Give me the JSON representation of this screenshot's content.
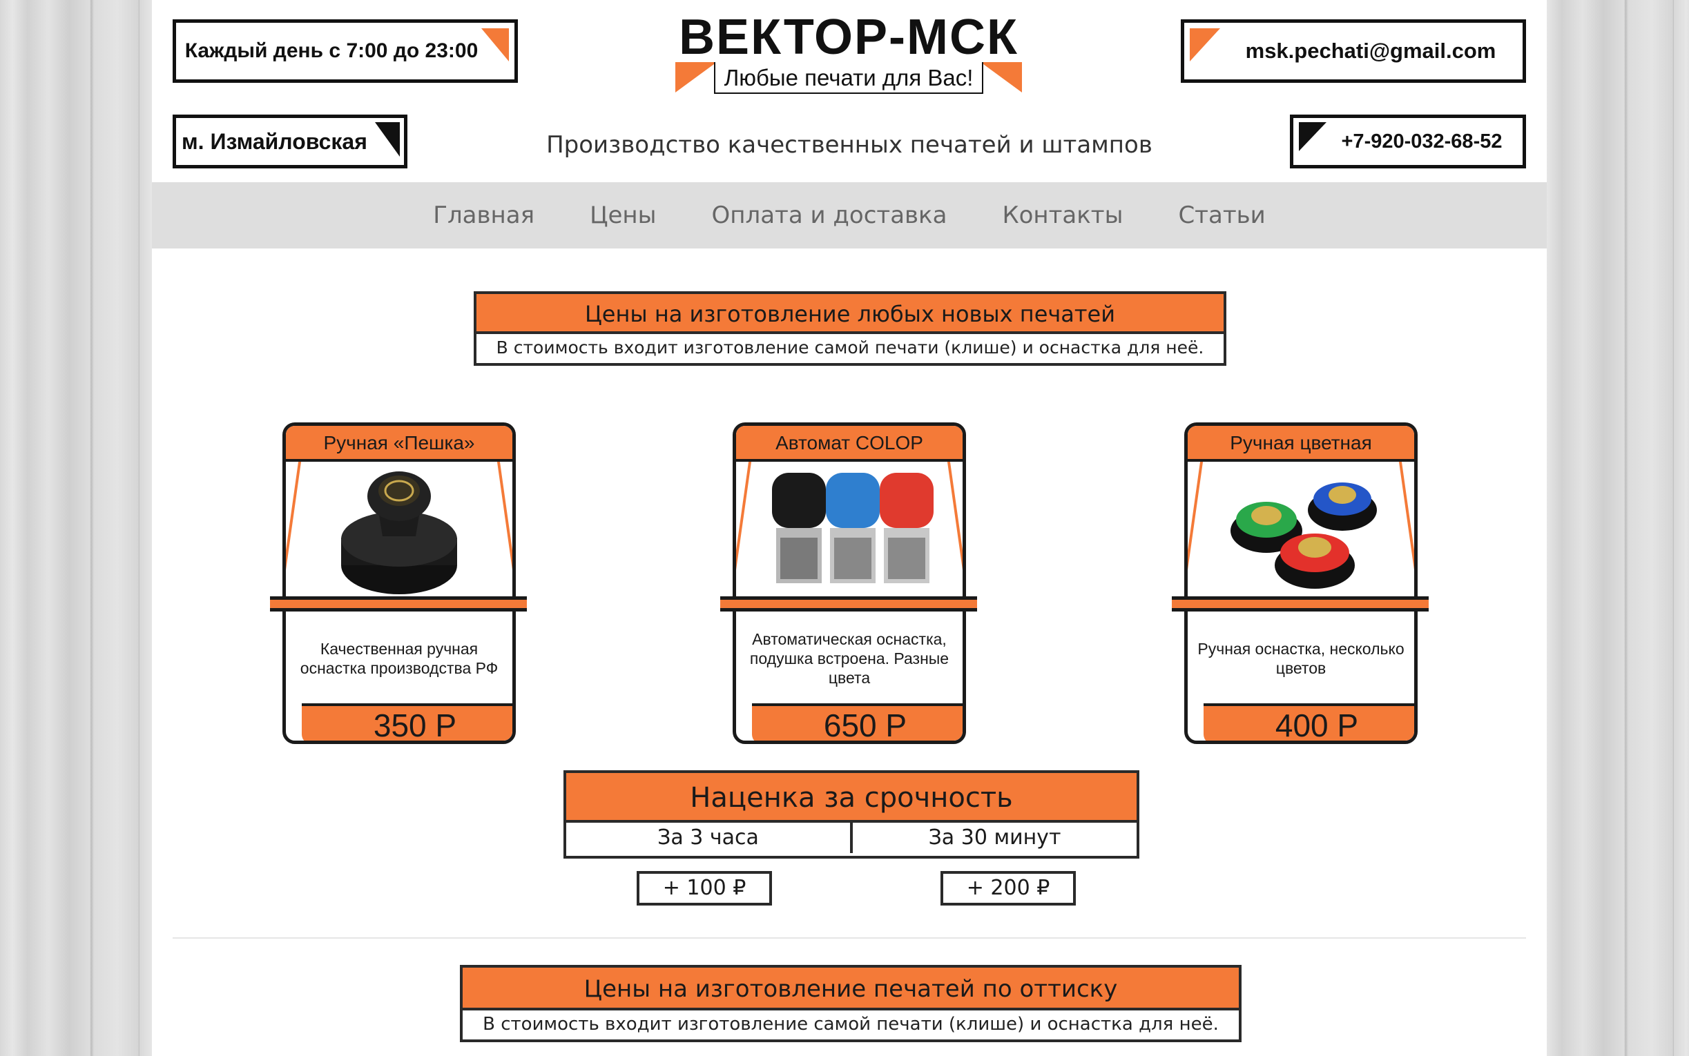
{
  "header": {
    "hours": "Каждый день с 7:00 до 23:00",
    "email": "msk.pechati@gmail.com",
    "metro": "м. Измайловская",
    "phone": "+7-920-032-68-52",
    "logo_title": "ВЕКТОР-МСК",
    "logo_subtitle": "Любые печати для Вас!",
    "tagline": "Производство качественных печатей и штампов"
  },
  "nav": {
    "items": [
      "Главная",
      "Цены",
      "Оплата и доставка",
      "Контакты",
      "Статьи"
    ]
  },
  "section1": {
    "title": "Цены на изготовление любых новых печатей",
    "subtitle": "В стоимость входит изготовление самой печати (клише) и оснастка для неё."
  },
  "products": [
    {
      "title": "Ручная «Пешка»",
      "desc": "Качественная ручная оснастка производства РФ",
      "price": "350 Р",
      "image": "black-hand-stamp"
    },
    {
      "title": "Автомат COLOP",
      "desc": "Автоматическая оснастка, подушка встроена. Разные цвета",
      "price": "650 Р",
      "image": "colop-auto-stamps"
    },
    {
      "title": "Ручная цветная",
      "desc": "Ручная оснастка, несколько цветов",
      "price": "400 Р",
      "image": "colored-hand-stamps"
    }
  ],
  "urgency": {
    "title": "Наценка за срочность",
    "options": [
      {
        "label": "За 3 часа",
        "price": "+ 100 ₽"
      },
      {
        "label": "За 30 минут",
        "price": "+ 200 ₽"
      }
    ]
  },
  "section2": {
    "title": "Цены на изготовление печатей по оттиску",
    "subtitle": "В стоимость входит изготовление самой печати (клише) и оснастка для неё."
  },
  "colors": {
    "accent": "#f47a38",
    "border": "#1a1a1a",
    "nav_bg": "#dedede"
  }
}
